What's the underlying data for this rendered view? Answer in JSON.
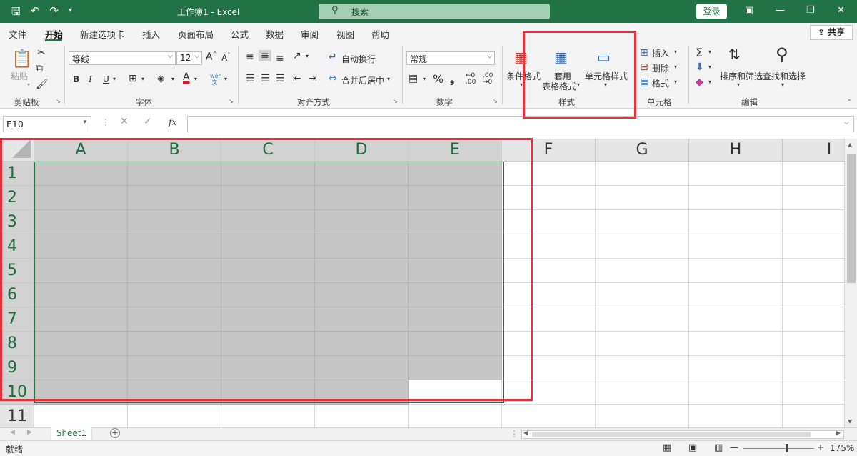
{
  "titlebar": {
    "title": "工作簿1  -  Excel",
    "search_placeholder": "搜索",
    "login": "登录"
  },
  "menu": {
    "tabs": [
      "文件",
      "开始",
      "新建选项卡",
      "插入",
      "页面布局",
      "公式",
      "数据",
      "审阅",
      "视图",
      "帮助"
    ],
    "active": "开始",
    "share": "共享"
  },
  "ribbon": {
    "clipboard": {
      "paste": "粘贴",
      "label": "剪贴板"
    },
    "font": {
      "name": "等线",
      "size": "12",
      "bold": "B",
      "italic": "I",
      "underline": "U",
      "label": "字体"
    },
    "alignment": {
      "wrap": "自动换行",
      "merge": "合并后居中",
      "label": "对齐方式"
    },
    "number": {
      "format": "常规",
      "label": "数字"
    },
    "styles": {
      "conditional": "条件格式",
      "table_line1": "套用",
      "table_line2": "表格格式",
      "cell": "单元格样式",
      "label": "样式"
    },
    "cells": {
      "insert": "插入",
      "delete": "删除",
      "format": "格式",
      "label": "单元格"
    },
    "editing": {
      "sort": "排序和筛选",
      "find": "查找和选择",
      "label": "编辑"
    }
  },
  "formula_bar": {
    "namebox": "E10",
    "fx": "fx",
    "content": ""
  },
  "grid": {
    "columns": [
      "A",
      "B",
      "C",
      "D",
      "E",
      "F",
      "G",
      "H",
      "I"
    ],
    "rows": [
      "1",
      "2",
      "3",
      "4",
      "5",
      "6",
      "7",
      "8",
      "9",
      "10",
      "11"
    ]
  },
  "sheet": {
    "tab": "Sheet1",
    "add": "+"
  },
  "status": {
    "text": "就绪",
    "zoom": "175%"
  },
  "colors": {
    "brand": "#217346",
    "highlight": "#e8313a",
    "selected_fill": "#c6c6c6"
  }
}
